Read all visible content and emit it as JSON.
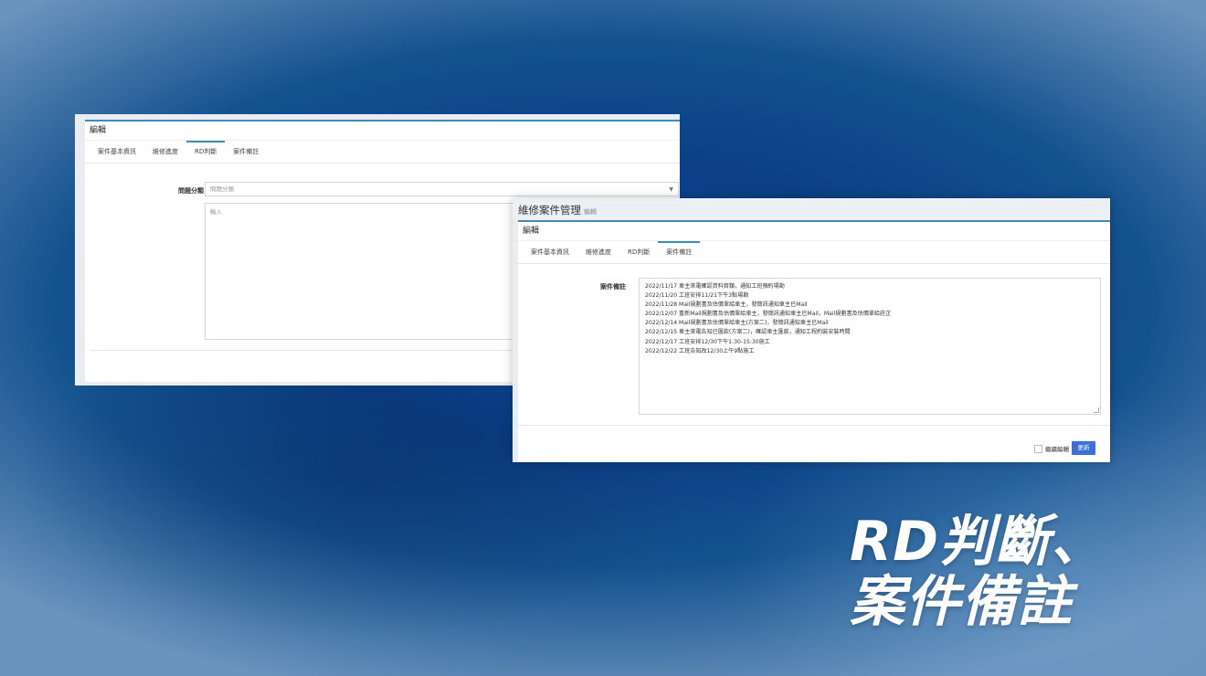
{
  "back_panel": {
    "card_title": "編輯",
    "tabs": [
      {
        "label": "案件基本資訊",
        "active": false
      },
      {
        "label": "維修進度",
        "active": false
      },
      {
        "label": "RD判斷",
        "active": true
      },
      {
        "label": "案件備註",
        "active": false
      }
    ],
    "field_label": "問題分類",
    "select_placeholder": "問題分類",
    "textarea_placeholder": "輸入"
  },
  "front_panel": {
    "page_title": "維修案件管理",
    "page_subtitle": "編輯",
    "card_title": "編輯",
    "tabs": [
      {
        "label": "案件基本資訊",
        "active": false
      },
      {
        "label": "維修進度",
        "active": false
      },
      {
        "label": "RD判斷",
        "active": false
      },
      {
        "label": "案件備註",
        "active": true
      }
    ],
    "field_label": "案件備註",
    "notes": [
      "2022/11/17 車主來電確認資料齊類，通知工班預約場勘",
      "2022/11/20 工班安排11/21下午3點場勘",
      "2022/11/28 Mail規劃書及估價單給車主，發簡訊通知車主已Mail",
      "2022/12/07 重新Mail規劃書及估價單給車主，發簡訊通知車主已Mail，Mail規劃書及估價單給莊芷",
      "2022/12/14 Mail規劃書及估價單給車主(方案二)，發簡訊通知車主已Mail",
      "2022/12/15 車主來電告知已匯款(方案二)，確認車主匯款，通知工程約裝安裝時間",
      "2022/12/17 工班安排12/30下午1:30-15:30施工",
      "2022/12/22 工班告知改12/30上午9點施工"
    ],
    "checkbox_label": "繼續編輯",
    "update_button": "更新"
  },
  "headline": {
    "line1": "RD判斷、",
    "line2": "案件備註"
  },
  "colors": {
    "accent": "#3c8dbc",
    "button": "#3c6fd6",
    "panel_bg": "#e9edf2"
  }
}
